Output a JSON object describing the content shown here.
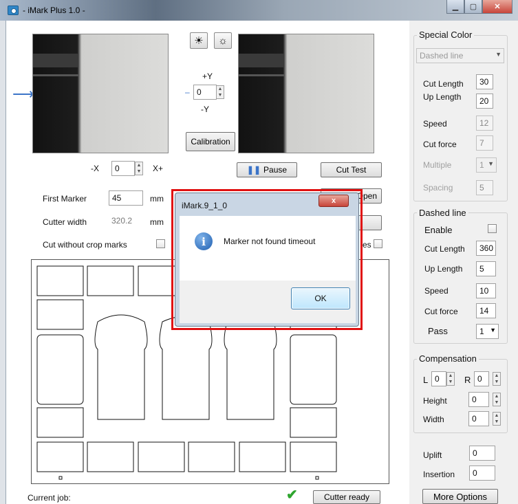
{
  "window": {
    "title": "- iMark Plus 1.0 -"
  },
  "camera": {
    "brightness_up_label": "☀",
    "brightness_down_label": "☼",
    "y_plus": "+Y",
    "y_minus": "-Y",
    "y_value": "0",
    "x_minus": "-X",
    "x_plus": "X+",
    "x_value": "0",
    "calibration_label": "Calibration"
  },
  "actions": {
    "pause_label": "Pause",
    "cut_test_label": "Cut Test",
    "open_label": "Open"
  },
  "settings": {
    "first_marker_label": "First Marker",
    "first_marker_value": "45",
    "first_marker_unit": "mm",
    "cutter_width_label": "Cutter width",
    "cutter_width_value": "320.2",
    "cutter_width_unit": "mm",
    "cut_without_crop_label": "Cut without crop marks",
    "partial_suffix": "es"
  },
  "status": {
    "current_job_label": "Current job:",
    "cutter_ready_label": "Cutter ready"
  },
  "special_color": {
    "title": "Special Color",
    "mode": "Dashed line",
    "cut_length_label": "Cut Length",
    "cut_length_value": "30",
    "up_length_label": "Up Length",
    "up_length_value": "20",
    "speed_label": "Speed",
    "speed_value": "12",
    "cut_force_label": "Cut force",
    "cut_force_value": "7",
    "multiple_label": "Multiple",
    "multiple_value": "1",
    "spacing_label": "Spacing",
    "spacing_value": "5"
  },
  "dashed_line": {
    "title": "Dashed line",
    "enable_label": "Enable",
    "cut_length_label": "Cut Length",
    "cut_length_value": "360",
    "up_length_label": "Up Length",
    "up_length_value": "5",
    "speed_label": "Speed",
    "speed_value": "10",
    "cut_force_label": "Cut force",
    "cut_force_value": "14",
    "pass_label": "Pass",
    "pass_value": "1"
  },
  "compensation": {
    "title": "Compensation",
    "l_label": "L",
    "l_value": "0",
    "r_label": "R",
    "r_value": "0",
    "height_label": "Height",
    "height_value": "0",
    "width_label": "Width",
    "width_value": "0"
  },
  "misc": {
    "uplift_label": "Uplift",
    "uplift_value": "0",
    "insertion_label": "Insertion",
    "insertion_value": "0",
    "more_options_label": "More Options"
  },
  "dialog": {
    "title": "iMark.9_1_0",
    "message": "Marker not found timeout",
    "ok_label": "OK",
    "close_label": "x"
  },
  "colors": {
    "highlight": "#e01010",
    "accent": "#3b74c8",
    "ready": "#2ea52e"
  }
}
